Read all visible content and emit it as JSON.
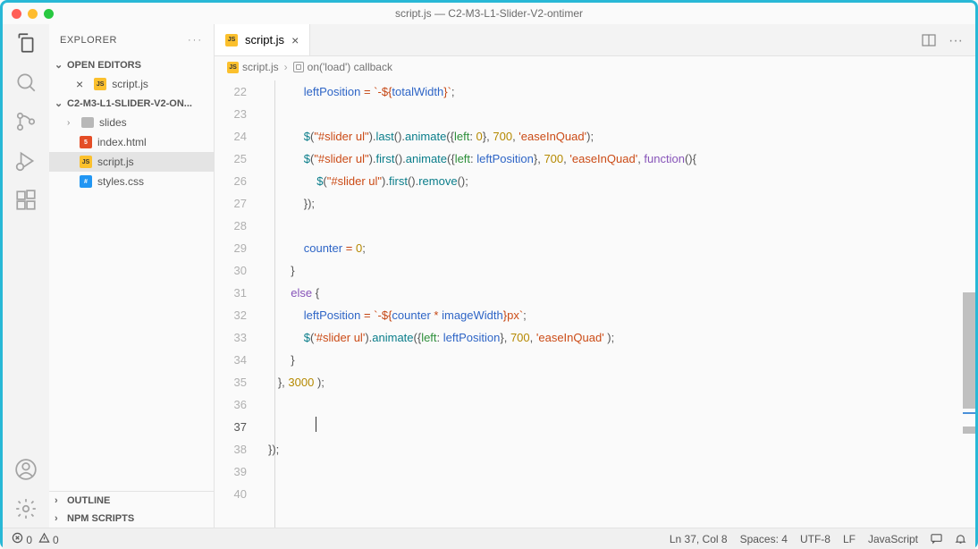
{
  "titlebar": "script.js — C2-M3-L1-Slider-V2-ontimer",
  "sidebar": {
    "title": "EXPLORER",
    "sections": {
      "openEditors": "OPEN EDITORS",
      "project": "C2-M3-L1-SLIDER-V2-ON...",
      "outline": "OUTLINE",
      "npm": "NPM SCRIPTS"
    },
    "openItems": [
      {
        "name": "script.js",
        "ico": "js"
      }
    ],
    "tree": [
      {
        "name": "slides",
        "type": "folder"
      },
      {
        "name": "index.html",
        "type": "file",
        "ico": "html"
      },
      {
        "name": "script.js",
        "type": "file",
        "ico": "js",
        "selected": true
      },
      {
        "name": "styles.css",
        "type": "file",
        "ico": "css"
      }
    ]
  },
  "tab": {
    "label": "script.js"
  },
  "breadcrumb": {
    "a": "script.js",
    "b": "on('load') callback"
  },
  "gutter": [
    "22",
    "23",
    "24",
    "25",
    "26",
    "27",
    "28",
    "29",
    "30",
    "31",
    "32",
    "33",
    "34",
    "35",
    "36",
    "37",
    "38",
    "39",
    "40"
  ],
  "code": {
    "l22": "           leftPosition = `-${totalWidth}`;",
    "eiq": "'easeInQuad'",
    "sliderSel": "\"#slider ul\"",
    "sliderSelS": "'#slider ul'",
    "func": "function",
    "el": "else",
    "cnt0": "0",
    "n700": "700",
    "n3000": "3000"
  },
  "status": {
    "err": "0",
    "warn": "0",
    "pos": "Ln 37, Col 8",
    "spaces": "Spaces: 4",
    "enc": "UTF-8",
    "eol": "LF",
    "lang": "JavaScript"
  }
}
